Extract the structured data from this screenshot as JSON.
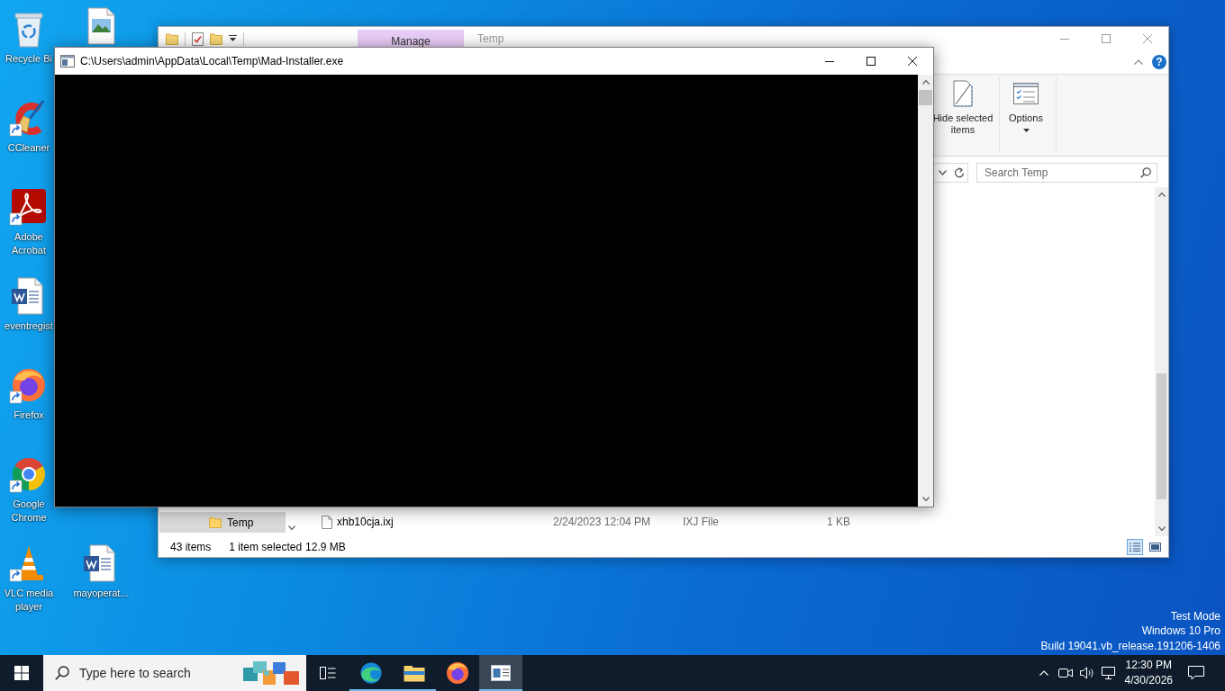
{
  "desktop": {
    "icons": [
      {
        "label": "Recycle Bi",
        "kind": "recycle-bin",
        "shortcut": false
      },
      {
        "label": "CCleaner",
        "kind": "ccleaner",
        "shortcut": true
      },
      {
        "label": "Adobe Acrobat",
        "kind": "acrobat",
        "shortcut": true
      },
      {
        "label": "eventregist",
        "kind": "word-doc",
        "shortcut": false
      },
      {
        "label": "Firefox",
        "kind": "firefox",
        "shortcut": true
      },
      {
        "label": "Google Chrome",
        "kind": "chrome",
        "shortcut": true
      },
      {
        "label": "VLC media player",
        "kind": "vlc",
        "shortcut": true
      },
      {
        "kind": "image-file",
        "shortcut": false
      },
      {
        "label": "mayoperat...",
        "kind": "word-doc",
        "shortcut": false
      }
    ],
    "system_info": [
      "Test Mode",
      "Windows 10 Pro",
      "Build 19041.vb_release.191206-1406"
    ]
  },
  "explorer": {
    "context_tab": "Manage",
    "title": "Temp",
    "help": "?",
    "ribbon": [
      {
        "label": "Hide selected items",
        "kind": "hide-selected",
        "dropdown": false
      },
      {
        "label": "Options",
        "kind": "options",
        "dropdown": true
      }
    ],
    "search": {
      "placeholder": "Search Temp"
    },
    "nav_items": [
      {
        "label": "Temp",
        "selected": true
      }
    ],
    "files": [
      {
        "name": "xhb10cja.ixj",
        "modified": "2/24/2023 12:04 PM",
        "type": "IXJ File",
        "size": "1 KB",
        "selected": false
      }
    ],
    "status": {
      "item_count": "43 items",
      "selection": "1 item selected",
      "selection_size": "12.9 MB"
    },
    "views": [
      {
        "kind": "details",
        "selected": true
      },
      {
        "kind": "large-icons",
        "selected": false
      }
    ]
  },
  "console": {
    "title": "C:\\Users\\admin\\AppData\\Local\\Temp\\Mad-Installer.exe"
  },
  "taskbar": {
    "search": {
      "placeholder": "Type here to search"
    },
    "apps": [
      {
        "kind": "task-view",
        "running": false,
        "active": false
      },
      {
        "kind": "edge",
        "running": true,
        "active": false
      },
      {
        "kind": "file-explorer",
        "running": true,
        "active": false
      },
      {
        "kind": "firefox",
        "running": false,
        "active": false
      },
      {
        "kind": "console",
        "running": true,
        "active": true
      }
    ],
    "clock": {
      "time": "12:30 PM",
      "date": "4/30/2026"
    }
  }
}
